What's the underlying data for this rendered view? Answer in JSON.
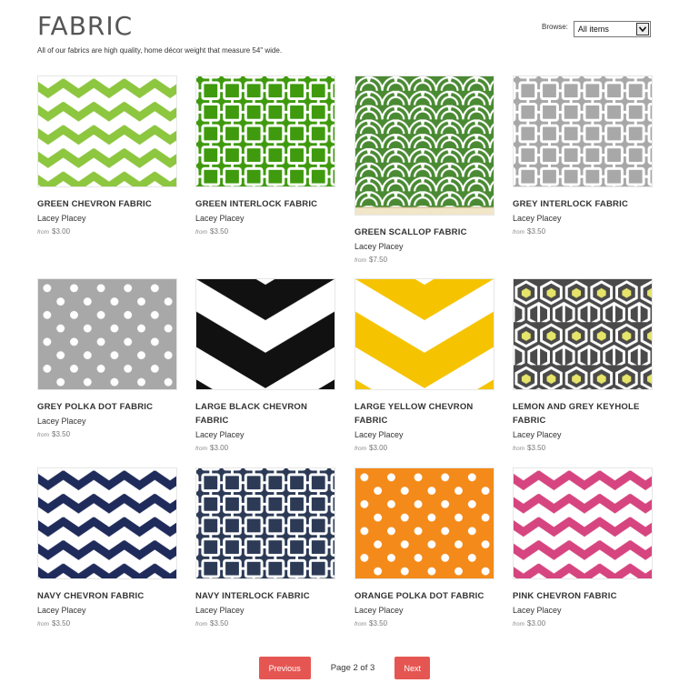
{
  "page": {
    "title": "FABRIC",
    "intro": "All of our fabrics are high quality, home décor weight that measure 54\" wide."
  },
  "browse": {
    "label": "Browse:",
    "selected": "All items"
  },
  "colors": {
    "accent": "#e55652"
  },
  "products": [
    {
      "name": "GREEN CHEVRON FABRIC",
      "vendor": "Lacey Placey",
      "price_prefix": "from",
      "price": "$3.00",
      "pattern": "chevron",
      "color": "#8dc63f"
    },
    {
      "name": "GREEN INTERLOCK FABRIC",
      "vendor": "Lacey Placey",
      "price_prefix": "from",
      "price": "$3.50",
      "pattern": "interlock",
      "color": "#3f9a0e"
    },
    {
      "name": "GREEN SCALLOP FABRIC",
      "vendor": "Lacey Placey",
      "price_prefix": "from",
      "price": "$7.50",
      "pattern": "scallop",
      "color": "#4a8a33"
    },
    {
      "name": "GREY INTERLOCK FABRIC",
      "vendor": "Lacey Placey",
      "price_prefix": "from",
      "price": "$3.50",
      "pattern": "interlock",
      "color": "#a8a8a8"
    },
    {
      "name": "GREY POLKA DOT FABRIC",
      "vendor": "Lacey Placey",
      "price_prefix": "from",
      "price": "$3.50",
      "pattern": "polka",
      "color": "#a8a8a8"
    },
    {
      "name": "LARGE BLACK CHEVRON FABRIC",
      "vendor": "Lacey Placey",
      "price_prefix": "from",
      "price": "$3.00",
      "pattern": "chevron-large",
      "color": "#111111"
    },
    {
      "name": "LARGE YELLOW CHEVRON FABRIC",
      "vendor": "Lacey Placey",
      "price_prefix": "from",
      "price": "$3.00",
      "pattern": "chevron-large",
      "color": "#f5c300"
    },
    {
      "name": "LEMON AND GREY KEYHOLE FABRIC",
      "vendor": "Lacey Placey",
      "price_prefix": "from",
      "price": "$3.50",
      "pattern": "keyhole",
      "color": "#4a4a4a"
    },
    {
      "name": "NAVY CHEVRON FABRIC",
      "vendor": "Lacey Placey",
      "price_prefix": "from",
      "price": "$3.50",
      "pattern": "chevron",
      "color": "#1f2b5a"
    },
    {
      "name": "NAVY INTERLOCK FABRIC",
      "vendor": "Lacey Placey",
      "price_prefix": "from",
      "price": "$3.50",
      "pattern": "interlock",
      "color": "#2c3a56"
    },
    {
      "name": "ORANGE POLKA DOT FABRIC",
      "vendor": "Lacey Placey",
      "price_prefix": "from",
      "price": "$3.50",
      "pattern": "polka",
      "color": "#f38a1a"
    },
    {
      "name": "PINK CHEVRON FABRIC",
      "vendor": "Lacey Placey",
      "price_prefix": "from",
      "price": "$3.00",
      "pattern": "chevron",
      "color": "#d6457f"
    }
  ],
  "pagination": {
    "previous_label": "Previous",
    "page_text": "Page 2 of 3",
    "next_label": "Next"
  }
}
